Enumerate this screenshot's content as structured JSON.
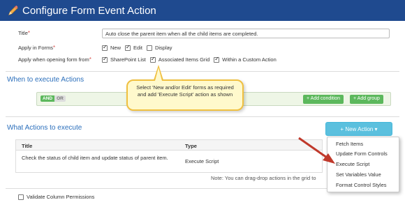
{
  "header": {
    "title": "Configure Form Event Action",
    "icon": "pencil-icon"
  },
  "form": {
    "title_label": "Title",
    "title_value": "Auto close the parent item when all the child items are completed.",
    "apply_forms_label": "Apply in Forms",
    "apply_forms_options": [
      {
        "label": "New",
        "checked": true
      },
      {
        "label": "Edit",
        "checked": true
      },
      {
        "label": "Display",
        "checked": false
      }
    ],
    "apply_opening_label": "Apply when opening form from",
    "apply_opening_options": [
      {
        "label": "SharePoint List",
        "checked": true
      },
      {
        "label": "Associated Items Grid",
        "checked": true
      },
      {
        "label": "Within a Custom Action",
        "checked": true
      }
    ],
    "required_marker": "*"
  },
  "when": {
    "heading": "When to execute Actions",
    "and_label": "AND",
    "or_label": "OR",
    "add_condition": "+ Add condition",
    "add_group": "+ Add group"
  },
  "tooltip": {
    "text": "Select 'New and/or Edit' forms as required and add 'Execute Script' action as shown"
  },
  "what": {
    "heading": "What Actions to execute",
    "new_action": "+ New Action ▾",
    "columns": [
      "Title",
      "Type"
    ],
    "rows": [
      {
        "title": "Check the status of child item and update status of parent item.",
        "type": "Execute Script"
      }
    ],
    "note": "Note: You can drag-drop actions in the grid to"
  },
  "menu": {
    "items": [
      "Fetch Items",
      "Update Form Controls",
      "Execute Script",
      "Set Variables Value",
      "Format Control Styles"
    ]
  },
  "footer": {
    "validate_label": "Validate Column Permissions",
    "validate_checked": false
  },
  "colors": {
    "header": "#1f4a8f",
    "accent": "#2a6ebb",
    "green": "#5cb85c",
    "info": "#5bc0de",
    "arrow": "#c0392b"
  }
}
